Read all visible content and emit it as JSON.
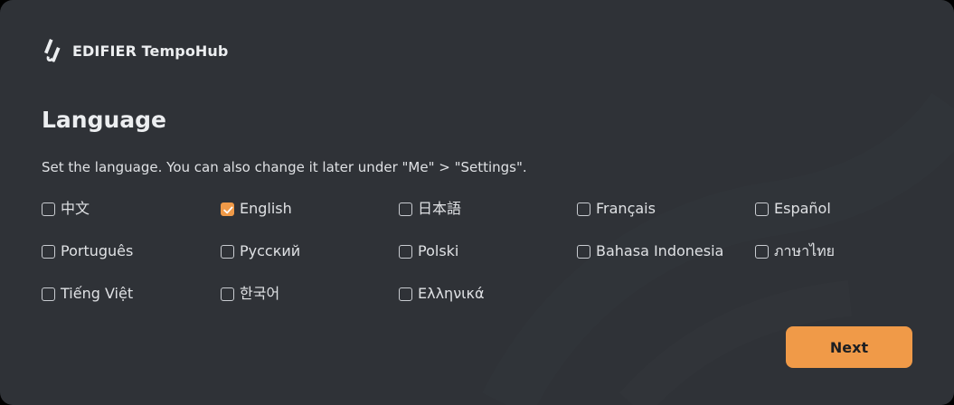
{
  "app": {
    "name": "EDIFIER TempoHub",
    "logo_icon": "edifier-logo-icon"
  },
  "page": {
    "title": "Language",
    "subtitle": "Set the language. You can also change it later under \"Me\" > \"Settings\"."
  },
  "languages": [
    {
      "label": "中文",
      "checked": false
    },
    {
      "label": "English",
      "checked": true
    },
    {
      "label": "日本語",
      "checked": false
    },
    {
      "label": "Français",
      "checked": false
    },
    {
      "label": "Español",
      "checked": false
    },
    {
      "label": "Português",
      "checked": false
    },
    {
      "label": "Русский",
      "checked": false
    },
    {
      "label": "Polski",
      "checked": false
    },
    {
      "label": "Bahasa Indonesia",
      "checked": false
    },
    {
      "label": "ภาษาไทย",
      "checked": false
    },
    {
      "label": "Tiếng Việt",
      "checked": false
    },
    {
      "label": "한국어",
      "checked": false
    },
    {
      "label": "Ελληνικά",
      "checked": false
    }
  ],
  "actions": {
    "next_label": "Next"
  },
  "colors": {
    "background": "#2f3237",
    "accent": "#f09a48",
    "text": "#dfe1e4"
  }
}
